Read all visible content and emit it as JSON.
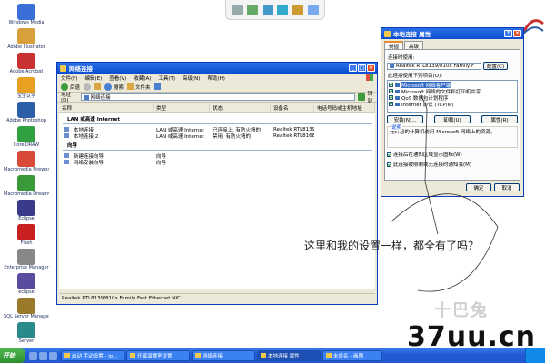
{
  "desktop": {
    "icons": [
      {
        "label": "Windows Media",
        "color": "#3a6fd8"
      },
      {
        "label": "Adobe Illustrator",
        "color": "#d8a03a"
      },
      {
        "label": "Adobe Acrobat",
        "color": "#c83232"
      },
      {
        "label": "宝宝认字",
        "color": "#e8a020"
      },
      {
        "label": "Adobe Photoshop",
        "color": "#2c5fa8"
      },
      {
        "label": "CorelDRAW",
        "color": "#30a040"
      },
      {
        "label": "Macromedia Fireworks",
        "color": "#d84a3a"
      },
      {
        "label": "Macromedia Dreamweaver",
        "color": "#3a9a3a"
      },
      {
        "label": "Eclipse",
        "color": "#3a3a8a"
      },
      {
        "label": "Flash",
        "color": "#c82020"
      },
      {
        "label": "Enterprise Manager",
        "color": "#888888"
      },
      {
        "label": "eclipse",
        "color": "#5a4aa0"
      },
      {
        "label": "SQL Server Manager",
        "color": "#9a7a2a"
      },
      {
        "label": "Server",
        "color": "#2a8a8a"
      }
    ]
  },
  "network_window": {
    "title": "网络连接",
    "menu": [
      "文件(F)",
      "编辑(E)",
      "查看(V)",
      "收藏(A)",
      "工具(T)",
      "高级(N)",
      "帮助(H)"
    ],
    "toolbar": {
      "back": "后退",
      "search": "搜索",
      "folders": "文件夹"
    },
    "address_label": "地址(D)",
    "address_value": "网络连接",
    "go_label": "转到",
    "columns": [
      "名称",
      "类型",
      "状态",
      "设备名",
      "电话号码或主机地址"
    ],
    "groups": [
      {
        "title": "LAN 或高速 Internet",
        "rows": [
          [
            "本地连接",
            "LAN 或高速 Internet",
            "已连接上, 有防火墙的",
            "Realtek RTL8139/810..."
          ],
          [
            "本地连接 2",
            "LAN 或高速 Internet",
            "禁用, 有防火墙的",
            "Realtek RTL8168/810..."
          ]
        ]
      },
      {
        "title": "向导",
        "rows": [
          [
            "新建连接向导",
            "向导",
            "",
            ""
          ],
          [
            "网络安装向导",
            "向导",
            "",
            ""
          ]
        ]
      }
    ],
    "status": "Realtek RTL8139/810x Family Fast Ethernet NIC"
  },
  "properties_dialog": {
    "title": "本地连接 属性",
    "tabs": [
      "常规",
      "高级"
    ],
    "connect_using_label": "连接时使用:",
    "adapter": "Realtek RTL8139/810x Family F",
    "configure_label": "配置(C)",
    "items_label": "此连接使用下列项目(O):",
    "items": [
      {
        "label": "Microsoft 网络客户端",
        "checked": true,
        "selected": true
      },
      {
        "label": "Microsoft 网络的文件和打印机共享",
        "checked": true,
        "selected": false
      },
      {
        "label": "QoS 数据包计划程序",
        "checked": true,
        "selected": false
      },
      {
        "label": "Internet 协议 (TCP/IP)",
        "checked": true,
        "selected": false
      }
    ],
    "install_label": "安装(N)...",
    "uninstall_label": "卸载(U)",
    "properties_label": "属性(R)",
    "description_legend": "说明",
    "description": "允许您的计算机访问 Microsoft 网络上的资源。",
    "show_icon_label": "连接后在通知区域显示图标(W)",
    "notify_label": "此连接被限制或无连接时通知我(M)",
    "ok_label": "确定",
    "cancel_label": "取消"
  },
  "annotation": {
    "text": "这里和我的设置一样，都全有了吗？"
  },
  "watermark": {
    "logo_text": "十巴兔",
    "site": "37uu.cn"
  },
  "taskbar": {
    "start": "开始",
    "tasks": [
      {
        "label": "启动 手动设置 - ip...",
        "active": false
      },
      {
        "label": "开幕演播室设置",
        "active": false
      },
      {
        "label": "网络连接",
        "active": false
      },
      {
        "label": "本地连接 属性",
        "active": true
      },
      {
        "label": "未命名 - 画图",
        "active": false
      }
    ]
  }
}
